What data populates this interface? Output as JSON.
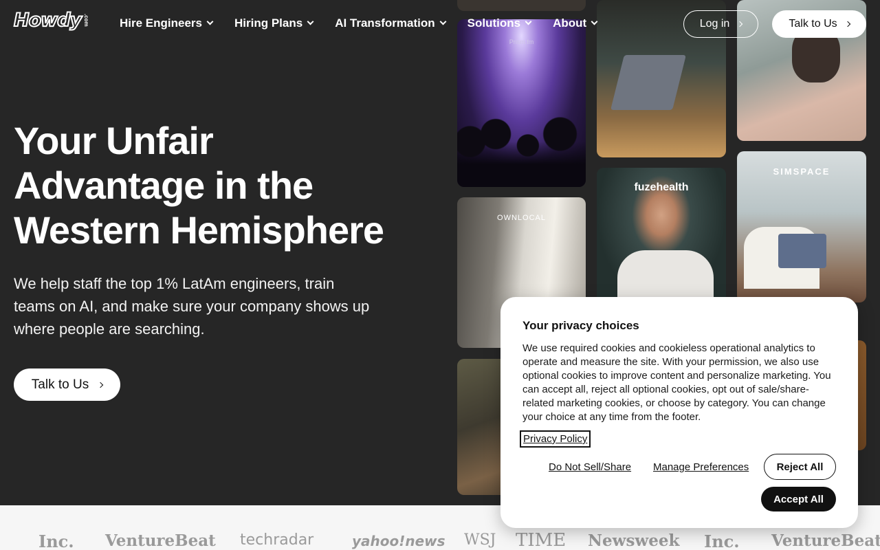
{
  "header": {
    "logo": "Howdy",
    "logo_sub": ".com",
    "nav": [
      {
        "label": "Hire Engineers"
      },
      {
        "label": "Hiring Plans"
      },
      {
        "label": "AI Transformation"
      },
      {
        "label": "Solutions"
      },
      {
        "label": "About"
      }
    ],
    "login_label": "Log in",
    "talk_label": "Talk to Us"
  },
  "hero": {
    "title_line1": "Your Unfair",
    "title_line2": "Advantage in the",
    "title_line3": "Western Hemisphere",
    "subtitle": "We help staff the top 1% LatAm engineers, train teams on AI, and make sure your company shows up where people are searching.",
    "cta_label": "Talk to Us"
  },
  "photos": {
    "brand_1": "Prism.fm",
    "brand_2": "OWNLOCAL",
    "brand_3": "fuzehealth",
    "brand_4": "SIMSPACE"
  },
  "press_logos": [
    "Inc.",
    "VentureBeat",
    "techradar",
    "yahoo!news",
    "WSJ",
    "TIME",
    "Newsweek",
    "Inc.",
    "VentureBeat"
  ],
  "privacy": {
    "title": "Your privacy choices",
    "body": "We use required cookies and cookieless operational analytics to operate and measure the site. With your permission, we also use optional cookies to improve content and personalize marketing. You can accept all, reject all optional cookies, opt out of sale/share-related marketing cookies, or choose by category. You can change your choice at any time from the footer.",
    "policy_link": "Privacy Policy",
    "do_not_sell": "Do Not Sell/Share",
    "manage": "Manage Preferences",
    "reject": "Reject All",
    "accept": "Accept All"
  },
  "colors": {
    "background": "#262626",
    "accent_dark": "#111111",
    "white": "#ffffff"
  }
}
